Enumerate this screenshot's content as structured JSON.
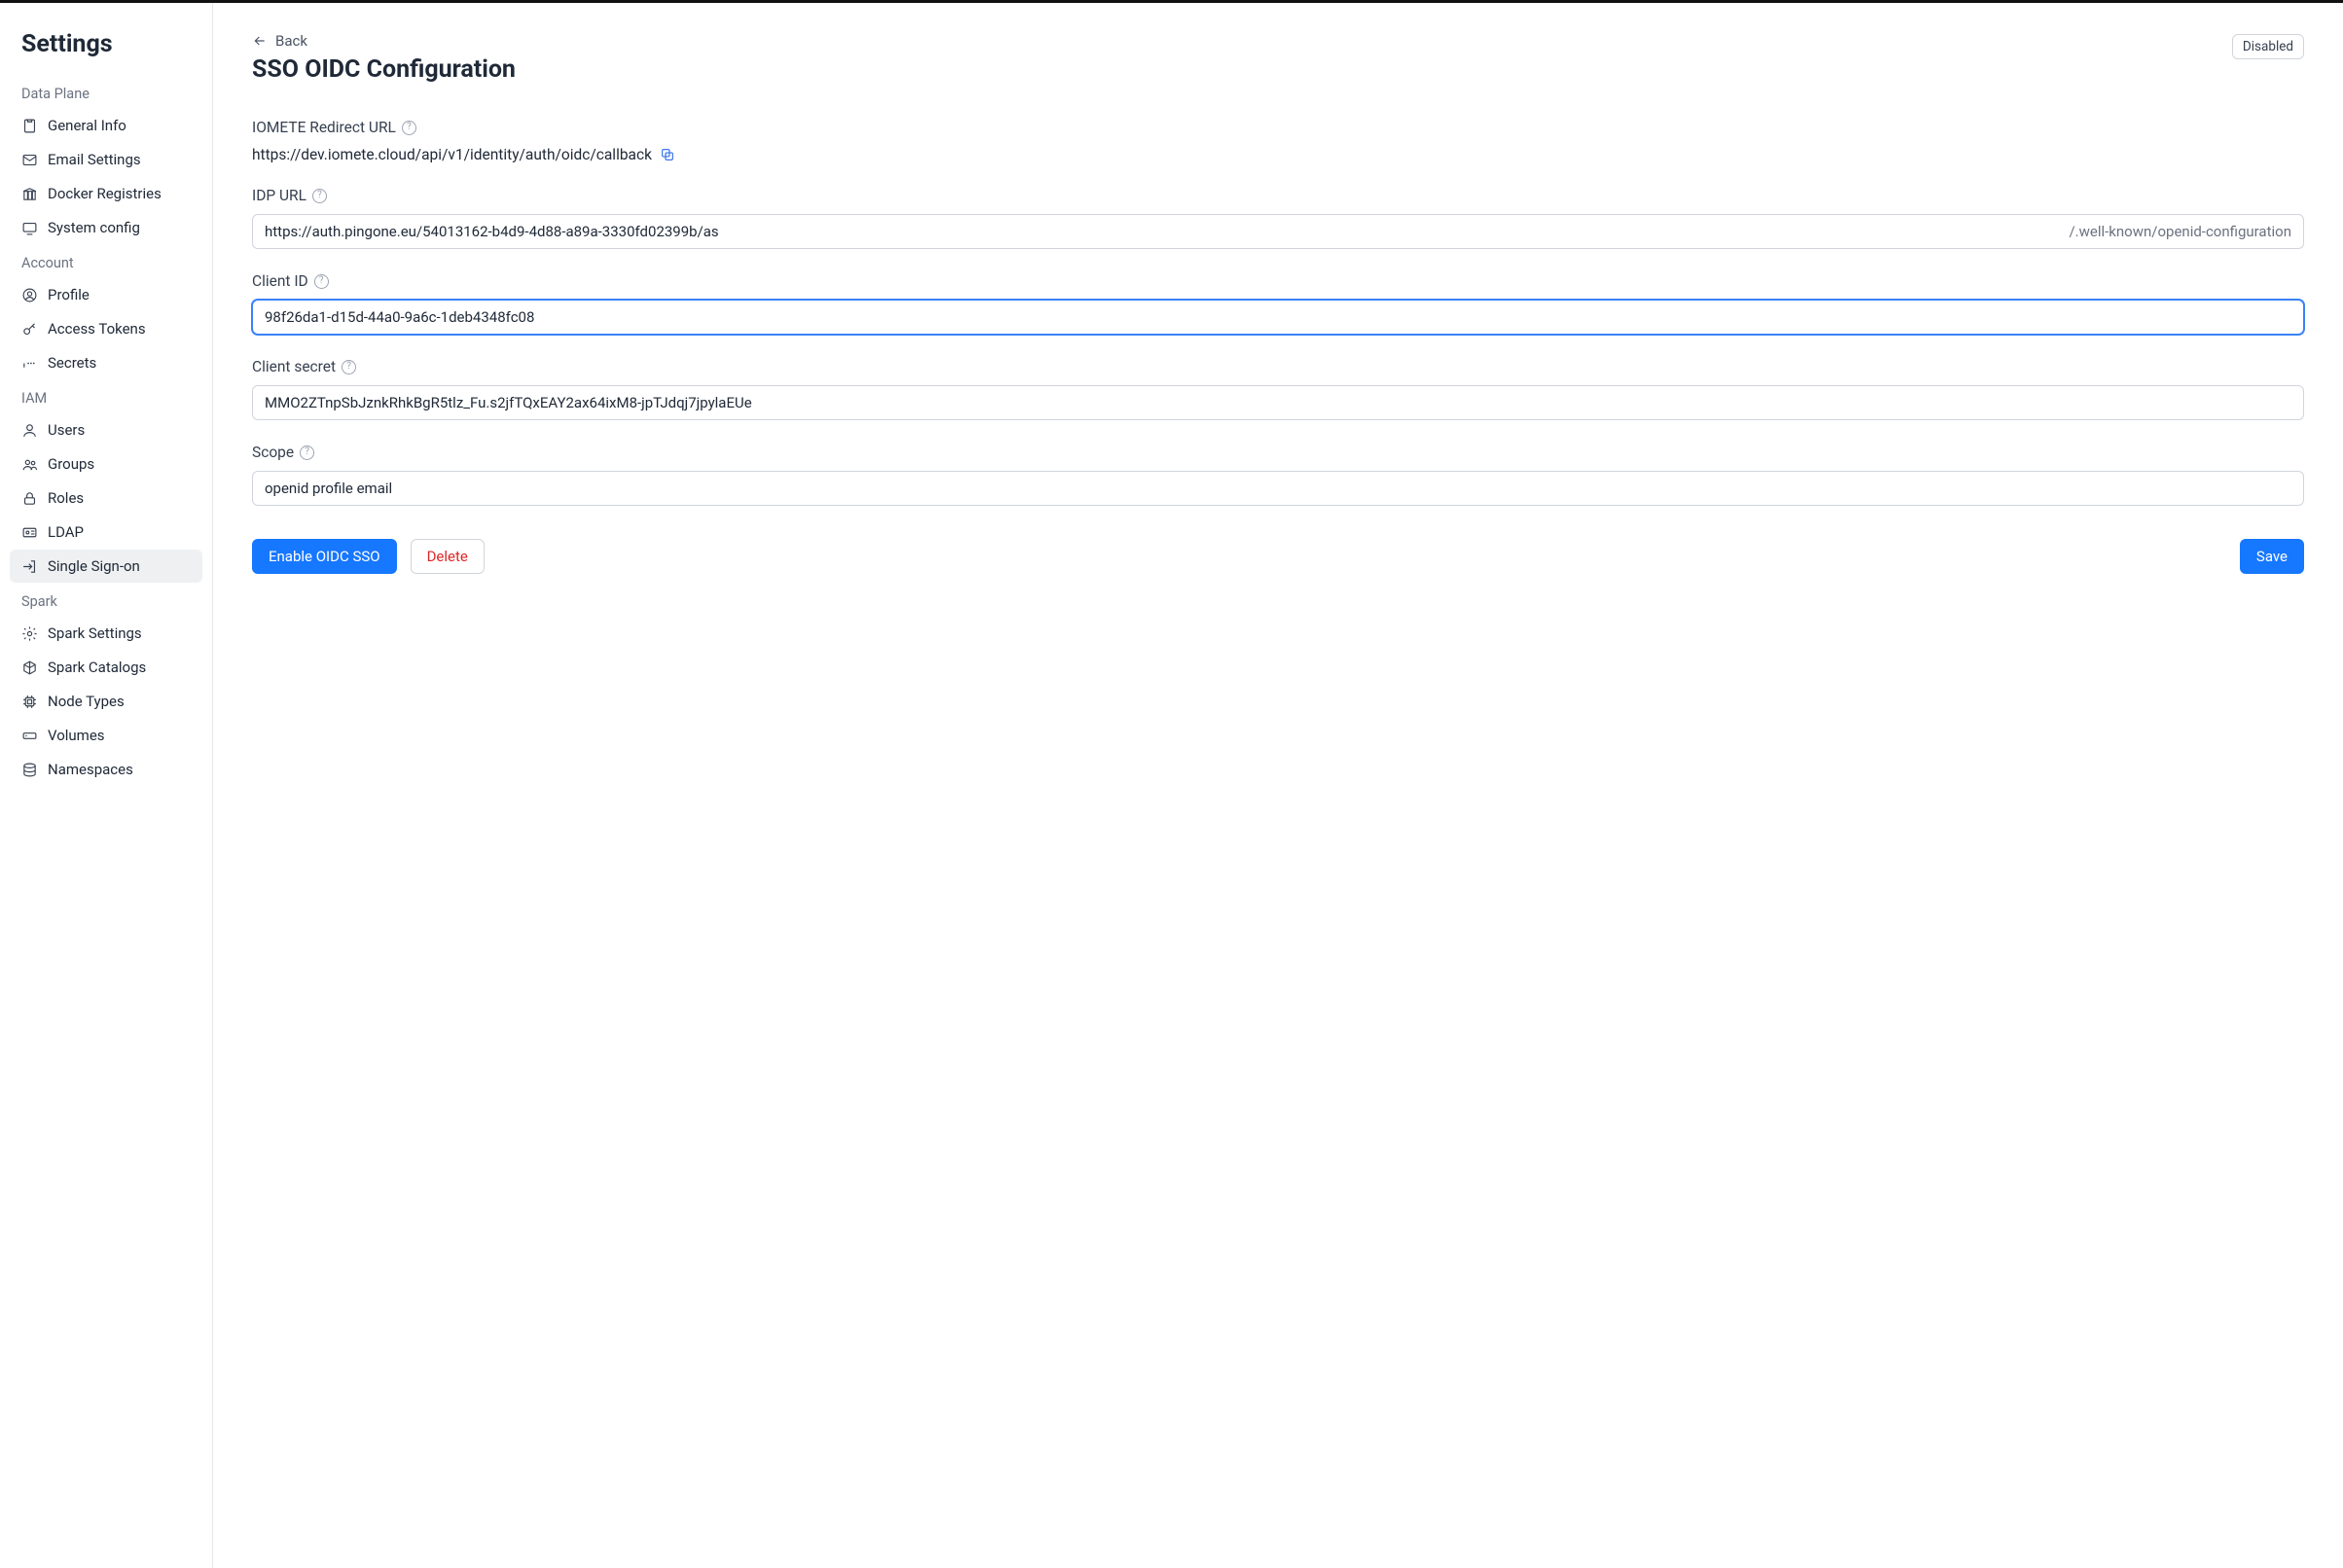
{
  "sidebar": {
    "title": "Settings",
    "sections": [
      {
        "label": "Data Plane",
        "items": [
          {
            "key": "general-info",
            "label": "General Info"
          },
          {
            "key": "email-settings",
            "label": "Email Settings"
          },
          {
            "key": "docker-registries",
            "label": "Docker Registries"
          },
          {
            "key": "system-config",
            "label": "System config"
          }
        ]
      },
      {
        "label": "Account",
        "items": [
          {
            "key": "profile",
            "label": "Profile"
          },
          {
            "key": "access-tokens",
            "label": "Access Tokens"
          },
          {
            "key": "secrets",
            "label": "Secrets"
          }
        ]
      },
      {
        "label": "IAM",
        "items": [
          {
            "key": "users",
            "label": "Users"
          },
          {
            "key": "groups",
            "label": "Groups"
          },
          {
            "key": "roles",
            "label": "Roles"
          },
          {
            "key": "ldap",
            "label": "LDAP"
          },
          {
            "key": "sso",
            "label": "Single Sign-on"
          }
        ]
      },
      {
        "label": "Spark",
        "items": [
          {
            "key": "spark-settings",
            "label": "Spark Settings"
          },
          {
            "key": "spark-catalogs",
            "label": "Spark Catalogs"
          },
          {
            "key": "node-types",
            "label": "Node Types"
          },
          {
            "key": "volumes",
            "label": "Volumes"
          },
          {
            "key": "namespaces",
            "label": "Namespaces"
          }
        ]
      }
    ]
  },
  "header": {
    "back": "Back",
    "title": "SSO OIDC Configuration",
    "status_badge": "Disabled"
  },
  "form": {
    "redirect_label": "IOMETE Redirect URL",
    "redirect_value": "https://dev.iomete.cloud/api/v1/identity/auth/oidc/callback",
    "idp_url_label": "IDP URL",
    "idp_url_value": "https://auth.pingone.eu/54013162-b4d9-4d88-a89a-3330fd02399b/as",
    "idp_url_suffix": "/.well-known/openid-configuration",
    "client_id_label": "Client ID",
    "client_id_value": "98f26da1-d15d-44a0-9a6c-1deb4348fc08",
    "client_secret_label": "Client secret",
    "client_secret_value": "MMO2ZTnpSbJznkRhkBgR5tlz_Fu.s2jfTQxEAY2ax64ixM8-jpTJdqj7jpylaEUe",
    "scope_label": "Scope",
    "scope_value": "openid profile email"
  },
  "actions": {
    "enable": "Enable OIDC SSO",
    "delete": "Delete",
    "save": "Save"
  }
}
